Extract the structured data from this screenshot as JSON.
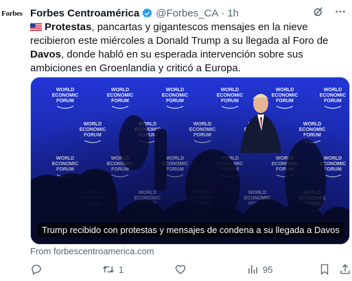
{
  "account": {
    "avatar_text": "Forbes",
    "name": "Forbes Centroamérica",
    "handle": "@Forbes_CA",
    "separator": "·",
    "time": "1h"
  },
  "tweet": {
    "part1": "Protestas",
    "part2": ", pancartas y gigantescos mensajes en la nieve recibieron este miércoles a Donald Trump a su llegada al Foro de ",
    "part3": "Davos",
    "part4": ", donde habló en su esperada intervención sobre sus ambiciones en Groenlandia y criticó a Europa."
  },
  "media": {
    "caption": "Trump recibido con protestas y mensajes de condena a su llegada a Davos",
    "backdrop_text": [
      "WORLD",
      "ECONOMIC",
      "FORUM"
    ]
  },
  "card": {
    "source": "From forbescentroamerica.com"
  },
  "actions": {
    "retweet_count": "1",
    "views_count": "95"
  },
  "colors": {
    "text": "#0f1419",
    "secondary": "#536471",
    "verified": "#1d9bf0",
    "media_blue": "#1b2bb8"
  }
}
